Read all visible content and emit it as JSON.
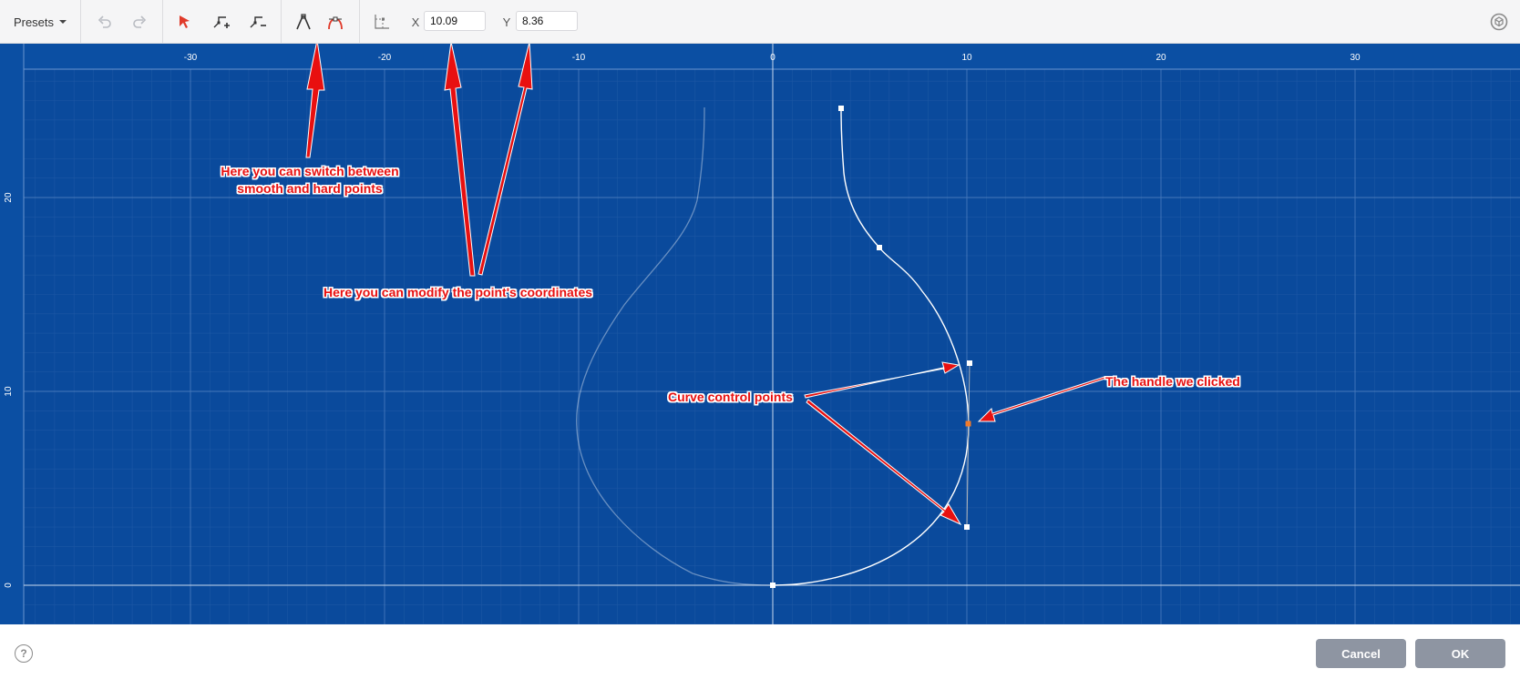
{
  "toolbar": {
    "presets_label": "Presets",
    "x_label": "X",
    "x_value": "10.09",
    "y_label": "Y",
    "y_value": "8.36"
  },
  "icons": {
    "undo": "undo-icon",
    "redo": "redo-icon",
    "select": "select-arrow-icon",
    "add_point": "add-point-icon",
    "remove_point": "remove-point-icon",
    "hard_point": "hard-point-icon",
    "smooth_point": "smooth-point-icon",
    "coordinates": "coordinates-icon",
    "view": "view-3d-icon",
    "help": "help-icon"
  },
  "canvas": {
    "x_ticks": [
      "-30",
      "-20",
      "-10",
      "0",
      "10",
      "20",
      "30"
    ],
    "y_ticks": [
      "20",
      "10",
      "0"
    ]
  },
  "annotations": {
    "switch_points": [
      "Here you can switch between",
      "smooth and hard points"
    ],
    "modify_coords": "Here you can modify the point's coordinates",
    "control_points": "Curve control points",
    "handle_clicked": "The handle we clicked"
  },
  "footer": {
    "help_symbol": "?",
    "cancel_label": "Cancel",
    "ok_label": "OK"
  },
  "colors": {
    "canvas_bg": "#0a4a9c",
    "accent": "#e03a2a",
    "annotation": "#e81010",
    "selected_handle": "#f07a2a"
  }
}
